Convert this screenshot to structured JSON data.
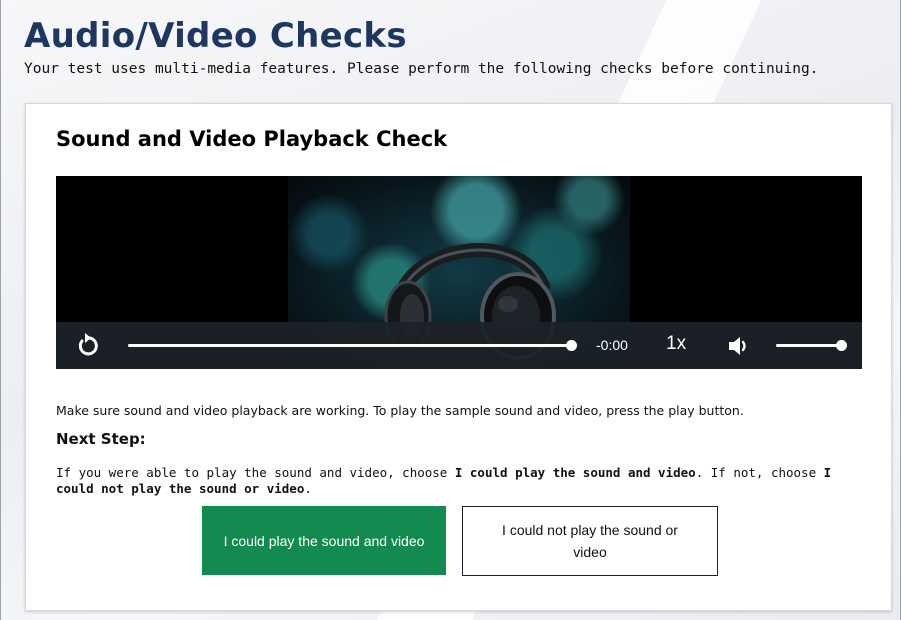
{
  "page": {
    "title": "Audio/Video Checks",
    "subtitle": "Your test uses multi-media features. Please perform the following checks before continuing."
  },
  "card": {
    "title": "Sound and Video Playback Check",
    "player": {
      "time": "-0:00",
      "speed": "1x",
      "progress_fraction": 1.0,
      "volume_fraction": 1.0,
      "icons": [
        "replay-icon",
        "volume-icon",
        "headphones-icon"
      ]
    },
    "instructions": "Make sure sound and video playback are working. To play the sample sound and video, press the play button.",
    "next_step_heading": "Next Step:",
    "next_step_text": {
      "part1": "If you were able to play the sound and video, choose ",
      "option1": "I could play the sound and video",
      "part2": ". If not, choose ",
      "option2": "I could not play the sound or video",
      "part3": "."
    },
    "buttons": {
      "yes": "I could play the sound and video",
      "no": "I could not play the sound or video"
    }
  },
  "colors": {
    "title": "#1d3760",
    "confirm_button": "#138a4f",
    "player_bar": "#1c2228"
  }
}
